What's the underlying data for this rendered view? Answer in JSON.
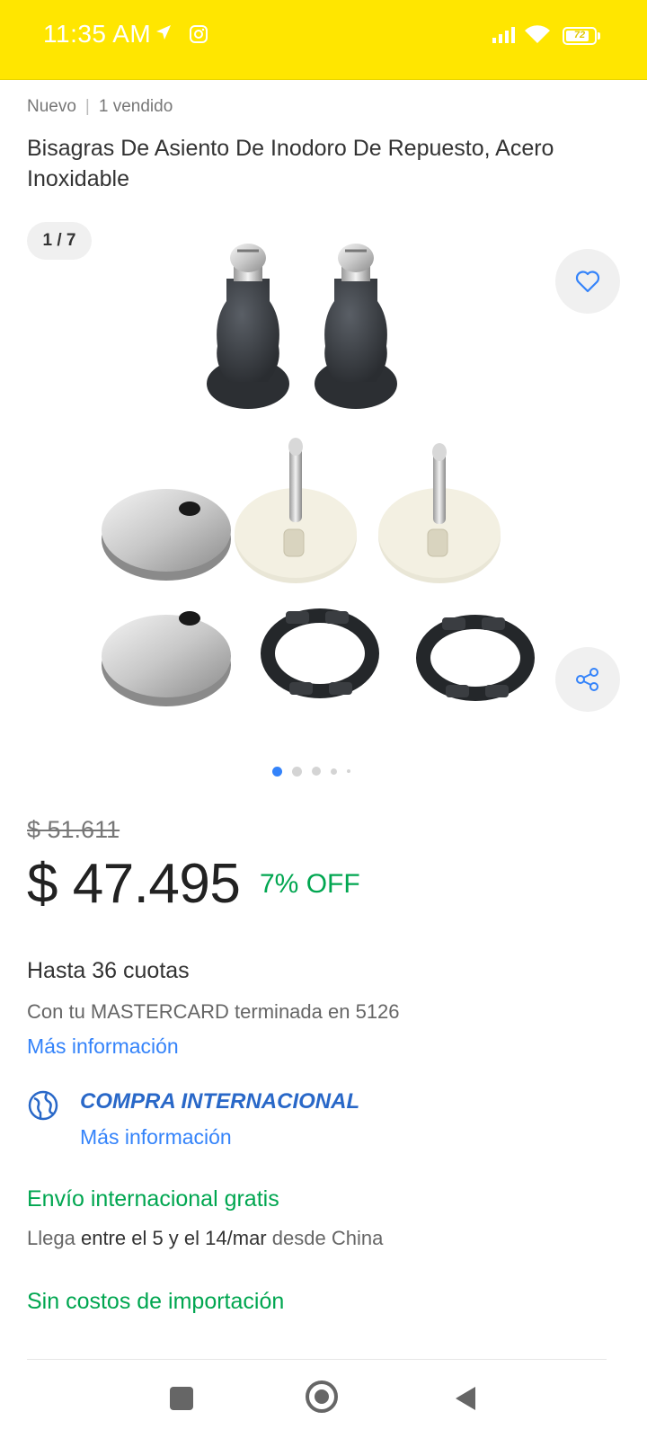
{
  "status_bar": {
    "time": "11:35 AM",
    "battery": "72"
  },
  "product": {
    "condition": "Nuevo",
    "sold": "1 vendido",
    "title": "Bisagras De Asiento De Inodoro De Repuesto, Acero Inoxidable",
    "image_counter": "1 / 7",
    "image_icon": "favorite-heart-icon",
    "share_icon": "share-icon"
  },
  "pricing": {
    "original_price": "$ 51.611",
    "price": "$ 47.495",
    "discount": "7% OFF"
  },
  "installments": {
    "title": "Hasta 36 cuotas",
    "card_text": "Con tu MASTERCARD terminada en 5126",
    "more_info": "Más información"
  },
  "international": {
    "title": "COMPRA INTERNACIONAL",
    "more_info": "Más información"
  },
  "shipping": {
    "title": "Envío internacional gratis",
    "detail_prefix": "Llega",
    "detail_dates": "entre el 5 y el 14/mar",
    "detail_suffix": "desde China"
  },
  "import": {
    "title": "Sin costos de importación"
  },
  "colors": {
    "brand_yellow": "#ffe600",
    "link_blue": "#3483fa",
    "success_green": "#00a650"
  }
}
